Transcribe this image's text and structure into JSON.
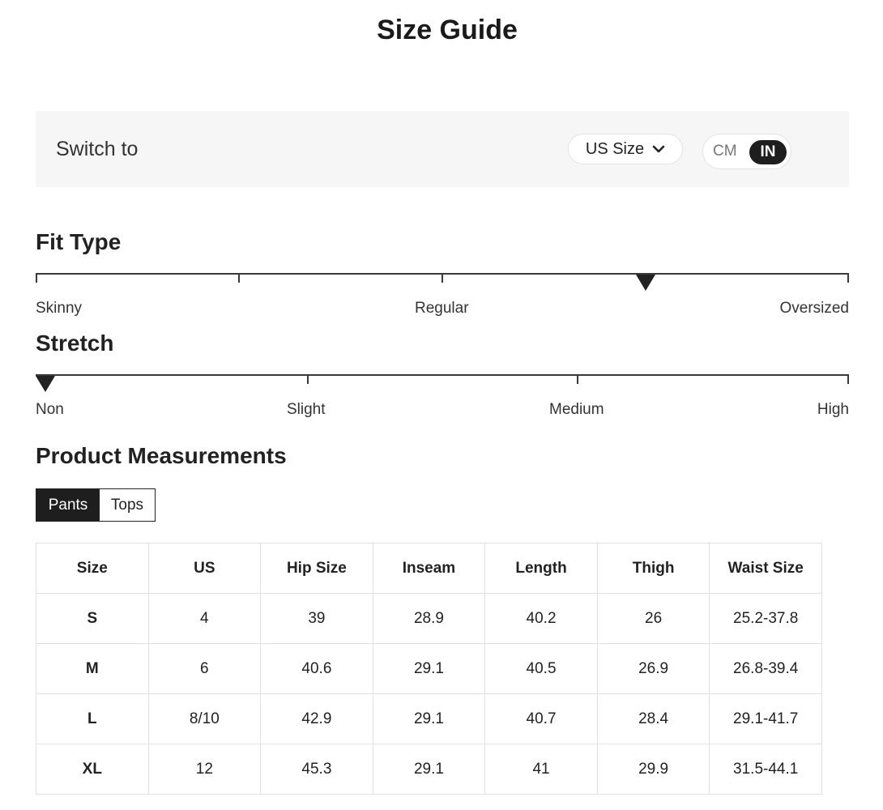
{
  "page": {
    "title": "Size Guide"
  },
  "switch_bar": {
    "label": "Switch to",
    "size_system": {
      "selected": "US Size",
      "icon": "chevron-down-icon"
    },
    "unit_toggle": {
      "options": [
        "CM",
        "IN"
      ],
      "selected": "IN"
    }
  },
  "fit_type": {
    "heading": "Fit Type",
    "labels": [
      "Skinny",
      "Regular",
      "Oversized"
    ],
    "selected_position": 0.75
  },
  "stretch": {
    "heading": "Stretch",
    "labels": [
      "Non",
      "Slight",
      "Medium",
      "High"
    ],
    "selected": "Non"
  },
  "measurements": {
    "heading": "Product Measurements",
    "tabs": [
      {
        "label": "Pants",
        "active": true
      },
      {
        "label": "Tops",
        "active": false
      }
    ],
    "columns": [
      "Size",
      "US",
      "Hip Size",
      "Inseam",
      "Length",
      "Thigh",
      "Waist Size"
    ],
    "rows": [
      [
        "S",
        "4",
        "39",
        "28.9",
        "40.2",
        "26",
        "25.2-37.8"
      ],
      [
        "M",
        "6",
        "40.6",
        "29.1",
        "40.5",
        "26.9",
        "26.8-39.4"
      ],
      [
        "L",
        "8/10",
        "42.9",
        "29.1",
        "40.7",
        "28.4",
        "29.1-41.7"
      ],
      [
        "XL",
        "12",
        "45.3",
        "29.1",
        "41",
        "29.9",
        "31.5-44.1"
      ]
    ]
  },
  "colors": {
    "accent": "#1e1e1e",
    "bar_bg": "#f6f6f6",
    "border": "#e0e0e0"
  }
}
